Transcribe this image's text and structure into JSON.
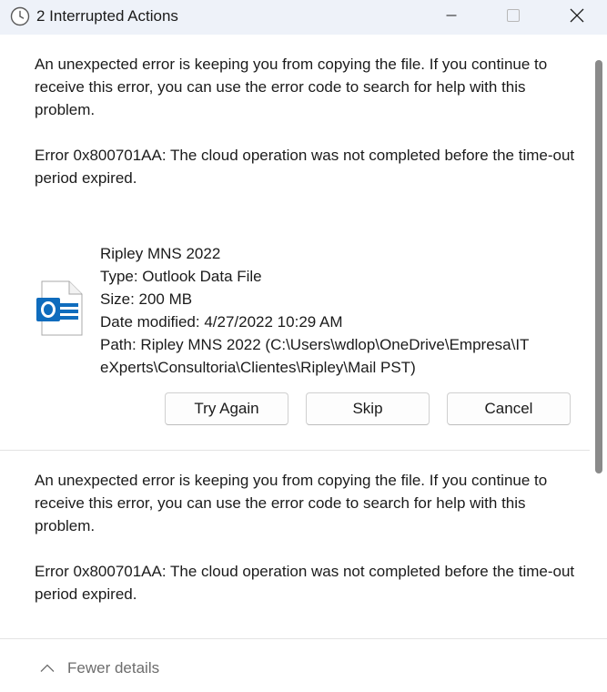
{
  "window": {
    "title": "2 Interrupted Actions",
    "icon": "clock-icon"
  },
  "error1": {
    "message": "An unexpected error is keeping you from copying the file. If you continue to receive this error, you can use the error code to search for help with this problem.",
    "code_text": "Error 0x800701AA: The cloud operation was not completed before the time-out period expired."
  },
  "file": {
    "icon": "outlook-data-file-icon",
    "name": "Ripley MNS 2022",
    "type": "Type: Outlook Data File",
    "size": "Size: 200 MB",
    "modified": "Date modified: 4/27/2022 10:29 AM",
    "path_line1": "Path: Ripley MNS 2022 (C:\\Users\\wdlop\\OneDrive\\Empresa\\IT",
    "path_line2": "eXperts\\Consultoria\\Clientes\\Ripley\\Mail PST)"
  },
  "actions": {
    "try_again": "Try Again",
    "skip": "Skip",
    "cancel": "Cancel"
  },
  "error2": {
    "message": "An unexpected error is keeping you from copying the file. If you continue to receive this error, you can use the error code to search for help with this problem.",
    "code_text": "Error 0x800701AA: The cloud operation was not completed before the time-out period expired."
  },
  "footer": {
    "toggle_label": "Fewer details",
    "toggle_icon": "chevron-up-icon"
  },
  "colors": {
    "titlebar_bg": "#eef2f9",
    "outlook_blue": "#0f6cbd",
    "muted_text": "#6d6d6d"
  }
}
